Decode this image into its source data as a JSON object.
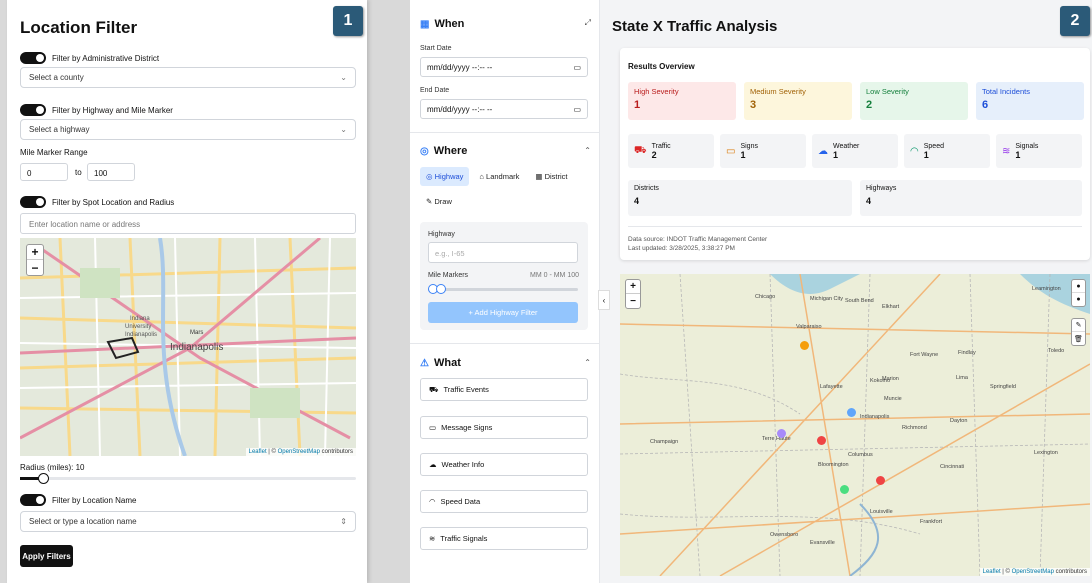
{
  "panel1": {
    "badge": "1",
    "title": "Location Filter",
    "toggle_district": "Filter by Administrative District",
    "select_county": "Select a county",
    "toggle_highway": "Filter by Highway and Mile Marker",
    "select_highway": "Select a highway",
    "mile_range_label": "Mile Marker Range",
    "mile_from": "0",
    "mile_to_label": "to",
    "mile_to": "100",
    "toggle_spot": "Filter by Spot Location and Radius",
    "location_placeholder": "Enter location name or address",
    "map": {
      "labels": [
        "Indianapolis",
        "Indiana University Indianapolis",
        "Mars"
      ],
      "attribution_prefix": "Leaflet",
      "attribution_sep": " | © ",
      "attribution_link": "OpenStreetMap",
      "attribution_suffix": " contributors"
    },
    "radius_label": "Radius (miles): 10",
    "radius_value": 10,
    "toggle_name": "Filter by Location Name",
    "select_name": "Select or type a location name",
    "apply_button": "Apply Filters"
  },
  "panel2": {
    "badge": "2",
    "when": {
      "title": "When",
      "start_label": "Start Date",
      "start_value": "mm/dd/yyyy --:-- --",
      "end_label": "End Date",
      "end_value": "mm/dd/yyyy --:-- --"
    },
    "where": {
      "title": "Where",
      "tabs": [
        "Highway",
        "Landmark",
        "District",
        "Draw"
      ],
      "highway_label": "Highway",
      "highway_placeholder": "e.g., I-65",
      "mile_markers_label": "Mile Markers",
      "mile_markers_range": "MM 0 - MM 100",
      "add_button": "+ Add Highway Filter"
    },
    "what": {
      "title": "What",
      "items": [
        "Traffic Events",
        "Message Signs",
        "Weather Info",
        "Speed Data",
        "Traffic Signals"
      ]
    },
    "main_title": "State X Traffic Analysis",
    "results": {
      "title": "Results Overview",
      "severity": [
        {
          "label": "High Severity",
          "value": "1",
          "bg": "#fde8e8",
          "fg": "#b91c1c"
        },
        {
          "label": "Medium Severity",
          "value": "3",
          "bg": "#fdf6dc",
          "fg": "#a16207"
        },
        {
          "label": "Low Severity",
          "value": "2",
          "bg": "#e6f6ea",
          "fg": "#15803d"
        },
        {
          "label": "Total Incidents",
          "value": "6",
          "bg": "#e6effb",
          "fg": "#1d4ed8"
        }
      ],
      "categories": [
        {
          "label": "Traffic",
          "value": "2",
          "icon": "car-icon",
          "color": "#dc2626"
        },
        {
          "label": "Signs",
          "value": "1",
          "icon": "message-icon",
          "color": "#d97706"
        },
        {
          "label": "Weather",
          "value": "1",
          "icon": "cloud-icon",
          "color": "#2563eb"
        },
        {
          "label": "Speed",
          "value": "1",
          "icon": "gauge-icon",
          "color": "#059669"
        },
        {
          "label": "Signals",
          "value": "1",
          "icon": "wifi-icon",
          "color": "#9333ea"
        }
      ],
      "districts_label": "Districts",
      "districts_value": "4",
      "highways_label": "Highways",
      "highways_value": "4",
      "source": "Data source: INDOT Traffic Management Center",
      "updated": "Last updated: 3/28/2025, 3:38:27 PM"
    },
    "map": {
      "cities": [
        "Chicago",
        "Michigan City",
        "South Bend",
        "Elkhart",
        "Valparaiso",
        "Fort Wayne",
        "Lafayette",
        "Kokomo",
        "Marion",
        "Muncie",
        "Terre Haute",
        "Bloomington",
        "Columbus",
        "Louisville",
        "Evansville",
        "Indianapolis",
        "Dayton",
        "Cincinnati",
        "Richmond",
        "Champaign",
        "Springfield",
        "Lexington",
        "Frankfort",
        "Owensboro",
        "Leamington",
        "Toledo",
        "Findlay",
        "Lima"
      ],
      "points": [
        {
          "color": "#f59e0b"
        },
        {
          "color": "#60a5fa"
        },
        {
          "color": "#a78bfa"
        },
        {
          "color": "#ef4444"
        },
        {
          "color": "#ef4444"
        },
        {
          "color": "#4ade80"
        }
      ],
      "attribution_prefix": "Leaflet",
      "attribution_sep": " | © ",
      "attribution_link": "OpenStreetMap",
      "attribution_suffix": " contributors"
    }
  }
}
